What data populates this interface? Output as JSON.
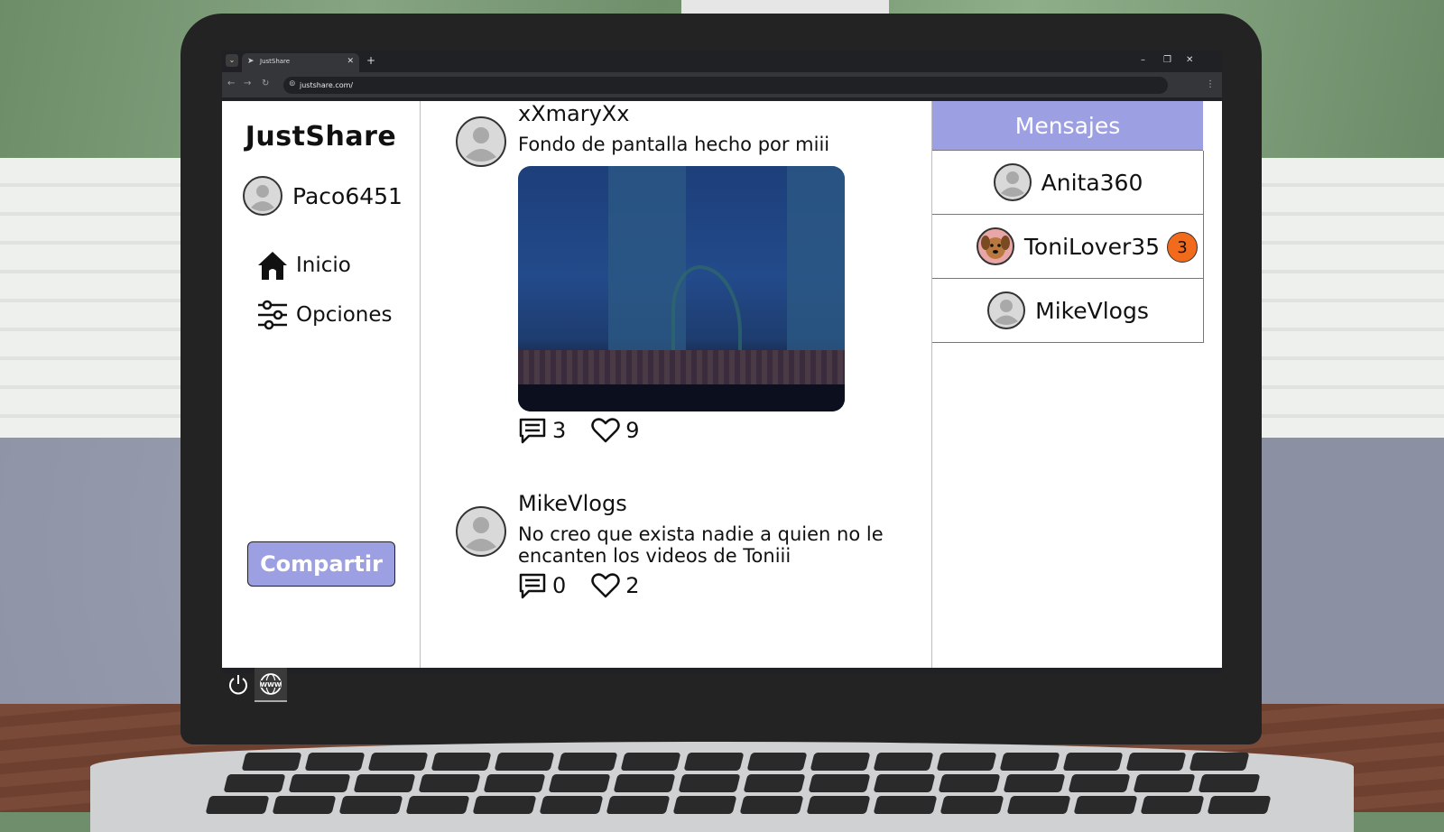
{
  "browser": {
    "tab_title": "JustShare",
    "url": "justshare.com/"
  },
  "app": {
    "logo": "JustShare",
    "current_user": "Paco6451",
    "nav": [
      {
        "label": "Inicio",
        "icon": "home-icon"
      },
      {
        "label": "Opciones",
        "icon": "sliders-icon"
      }
    ],
    "share_button": "Compartir"
  },
  "feed": {
    "posts": [
      {
        "user": "xXmaryXx",
        "text": "Fondo de pantalla hecho por miii",
        "comments": "3",
        "likes": "9",
        "has_image": true
      },
      {
        "user": "MikeVlogs",
        "text": "No creo que exista nadie a quien no le encanten los videos de Toniii",
        "comments": "0",
        "likes": "2",
        "has_image": false
      }
    ]
  },
  "messages": {
    "title": "Mensajes",
    "items": [
      {
        "name": "Anita360",
        "avatar": "default-avatar"
      },
      {
        "name": "ToniLover35",
        "avatar": "dog-avatar",
        "unread": "3"
      },
      {
        "name": "MikeVlogs",
        "avatar": "default-avatar"
      }
    ]
  },
  "colors": {
    "accent": "#9d9fe3",
    "badge": "#f26a1b"
  }
}
